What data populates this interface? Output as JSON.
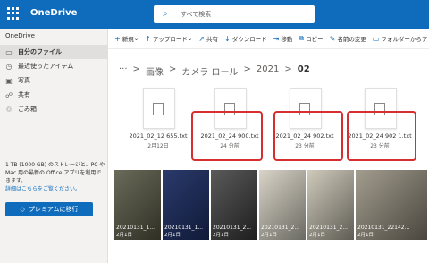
{
  "topbar": {
    "brand": "OneDrive",
    "search_placeholder": "すべて検索"
  },
  "sidebar": {
    "title": "OneDrive",
    "items": [
      {
        "label": "自分のファイル",
        "icon": "folder-icon"
      },
      {
        "label": "最近使ったアイテム",
        "icon": "clock-icon"
      },
      {
        "label": "写真",
        "icon": "image-icon"
      },
      {
        "label": "共有",
        "icon": "share-icon"
      },
      {
        "label": "ごみ箱",
        "icon": "trash-icon"
      }
    ],
    "storage_text": "1 TB (1000 GB) のストレージと、PC や Mac 用の最新の Office アプリを利用できます。",
    "storage_link": "詳細はこちらをご覧ください。",
    "premium_button": "プレミアムに移行"
  },
  "commands": [
    {
      "label": "新規",
      "icon": "plus-icon"
    },
    {
      "label": "アップロード",
      "icon": "upload-icon"
    },
    {
      "label": "共有",
      "icon": "share-icon"
    },
    {
      "label": "ダウンロード",
      "icon": "download-icon"
    },
    {
      "label": "移動",
      "icon": "move-icon"
    },
    {
      "label": "コピー",
      "icon": "copy-icon"
    },
    {
      "label": "名前の変更",
      "icon": "rename-icon"
    },
    {
      "label": "フォルダーからア",
      "icon": "folder-icon"
    }
  ],
  "breadcrumb": {
    "items": [
      "画像",
      "カメラ ロール",
      "2021"
    ],
    "current": "02",
    "separator": ">"
  },
  "files": [
    {
      "name": "2021_02_12 655.txt",
      "date": "2月12日"
    },
    {
      "name": "2021_02_24 900.txt",
      "date": "24 分前"
    },
    {
      "name": "2021_02_24 902.txt",
      "date": "23 分前"
    },
    {
      "name": "2021_02_24 902 1.txt",
      "date": "23 分前"
    }
  ],
  "photos": [
    {
      "label": "20210131_1...",
      "date": "2月1日"
    },
    {
      "label": "20210131_1...",
      "date": "2月1日"
    },
    {
      "label": "20210131_2...",
      "date": "2月1日"
    },
    {
      "label": "20210131_2...",
      "date": "2月1日"
    },
    {
      "label": "20210131_2...",
      "date": "2月1日"
    },
    {
      "label": "20210131_22142...",
      "date": "2月1日"
    }
  ],
  "colors": {
    "accent": "#0f6cbd",
    "highlight": "#d62f2f"
  }
}
